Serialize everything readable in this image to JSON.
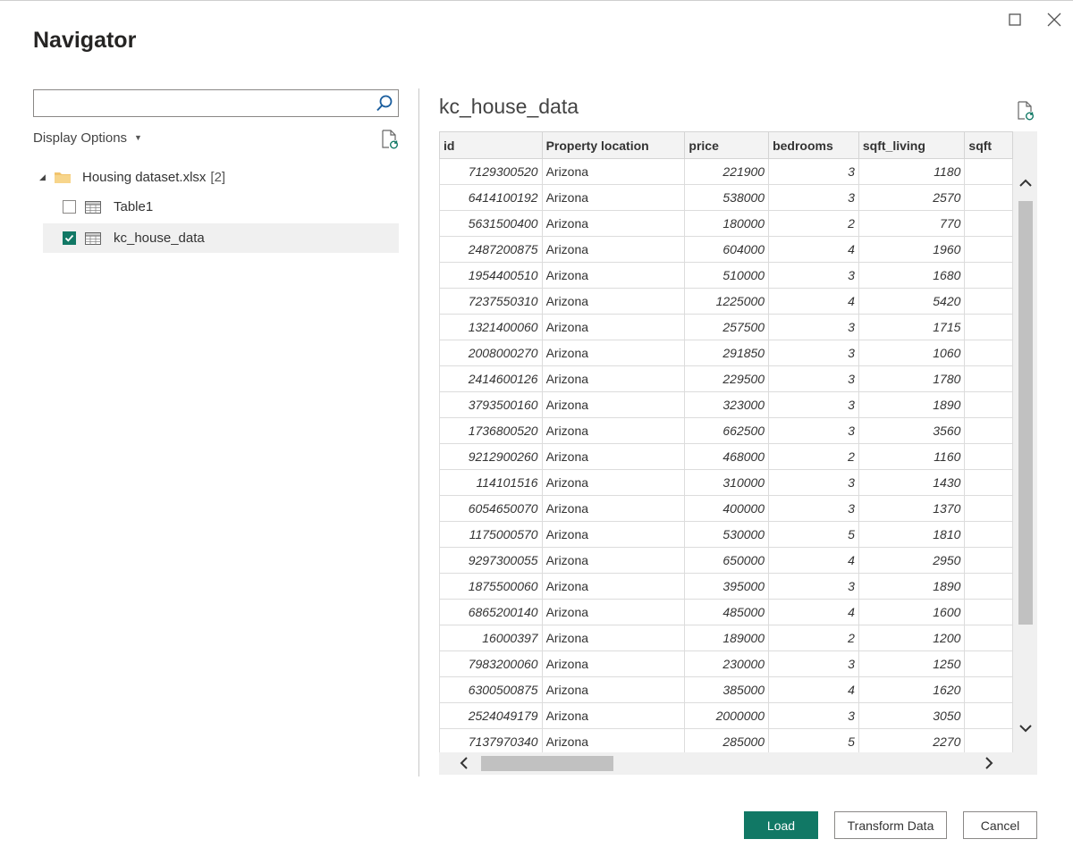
{
  "window": {
    "title": "Navigator"
  },
  "search": {
    "value": "",
    "placeholder": ""
  },
  "display_options": {
    "label": "Display Options"
  },
  "tree": {
    "root": {
      "name": "Housing dataset.xlsx",
      "count": "[2]"
    },
    "items": [
      {
        "name": "Table1",
        "checked": false
      },
      {
        "name": "kc_house_data",
        "checked": true
      }
    ]
  },
  "preview": {
    "title": "kc_house_data",
    "columns": [
      "id",
      "Property location",
      "price",
      "bedrooms",
      "sqft_living",
      "sqft"
    ],
    "rows": [
      [
        "7129300520",
        "Arizona",
        "221900",
        "3",
        "1180"
      ],
      [
        "6414100192",
        "Arizona",
        "538000",
        "3",
        "2570"
      ],
      [
        "5631500400",
        "Arizona",
        "180000",
        "2",
        "770"
      ],
      [
        "2487200875",
        "Arizona",
        "604000",
        "4",
        "1960"
      ],
      [
        "1954400510",
        "Arizona",
        "510000",
        "3",
        "1680"
      ],
      [
        "7237550310",
        "Arizona",
        "1225000",
        "4",
        "5420"
      ],
      [
        "1321400060",
        "Arizona",
        "257500",
        "3",
        "1715"
      ],
      [
        "2008000270",
        "Arizona",
        "291850",
        "3",
        "1060"
      ],
      [
        "2414600126",
        "Arizona",
        "229500",
        "3",
        "1780"
      ],
      [
        "3793500160",
        "Arizona",
        "323000",
        "3",
        "1890"
      ],
      [
        "1736800520",
        "Arizona",
        "662500",
        "3",
        "3560"
      ],
      [
        "9212900260",
        "Arizona",
        "468000",
        "2",
        "1160"
      ],
      [
        "114101516",
        "Arizona",
        "310000",
        "3",
        "1430"
      ],
      [
        "6054650070",
        "Arizona",
        "400000",
        "3",
        "1370"
      ],
      [
        "1175000570",
        "Arizona",
        "530000",
        "5",
        "1810"
      ],
      [
        "9297300055",
        "Arizona",
        "650000",
        "4",
        "2950"
      ],
      [
        "1875500060",
        "Arizona",
        "395000",
        "3",
        "1890"
      ],
      [
        "6865200140",
        "Arizona",
        "485000",
        "4",
        "1600"
      ],
      [
        "16000397",
        "Arizona",
        "189000",
        "2",
        "1200"
      ],
      [
        "7983200060",
        "Arizona",
        "230000",
        "3",
        "1250"
      ],
      [
        "6300500875",
        "Arizona",
        "385000",
        "4",
        "1620"
      ],
      [
        "2524049179",
        "Arizona",
        "2000000",
        "3",
        "3050"
      ],
      [
        "7137970340",
        "Arizona",
        "285000",
        "5",
        "2270"
      ]
    ]
  },
  "buttons": {
    "load": "Load",
    "transform": "Transform Data",
    "cancel": "Cancel"
  },
  "icons": {
    "maximize": "maximize-icon",
    "close": "close-icon",
    "search": "search-icon",
    "refresh": "refresh-document-icon",
    "folder": "folder-icon",
    "table": "table-icon"
  },
  "colors": {
    "accent": "#117865"
  }
}
